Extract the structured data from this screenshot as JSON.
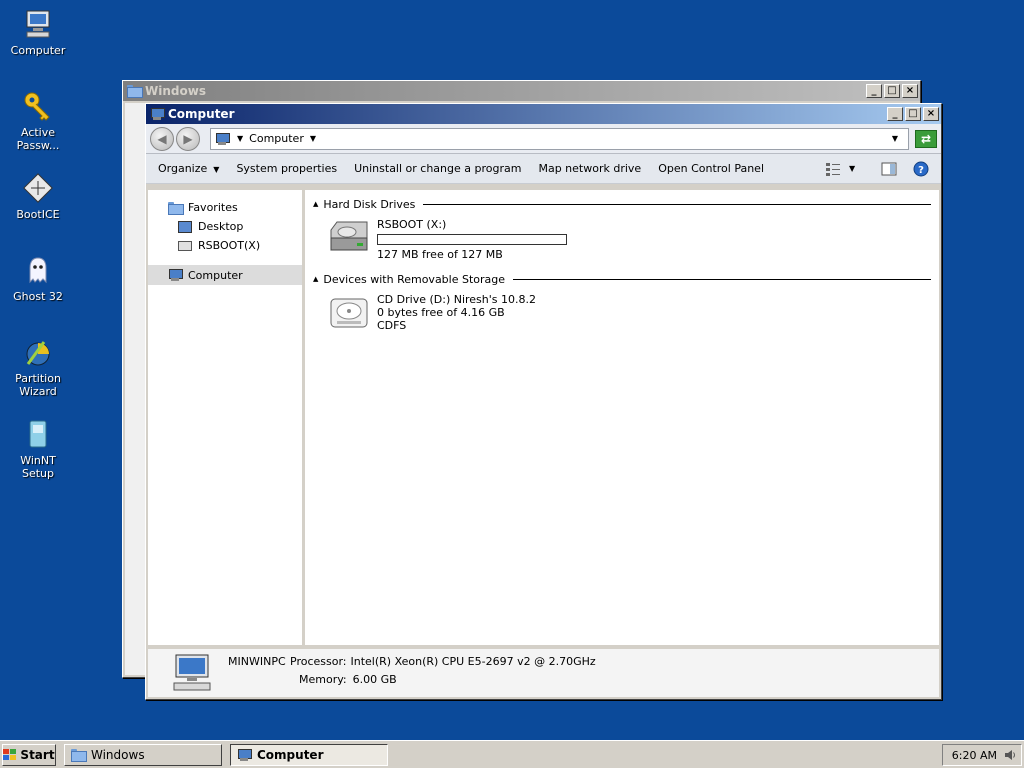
{
  "desktop": {
    "icons": [
      {
        "label": "Computer",
        "icon": "computer-icon"
      },
      {
        "label": "Active\nPassw...",
        "icon": "key-icon"
      },
      {
        "label": "BootICE",
        "icon": "bootice-icon"
      },
      {
        "label": "Ghost 32",
        "icon": "ghost-icon"
      },
      {
        "label": "Partition\nWizard",
        "icon": "partition-wizard-icon"
      },
      {
        "label": "WinNT Setup",
        "icon": "winnt-setup-icon"
      }
    ]
  },
  "back_window": {
    "title": "Windows",
    "controls": {
      "minimize": "_",
      "maximize": "□",
      "close": "×"
    }
  },
  "window": {
    "title": "Computer",
    "controls": {
      "minimize": "_",
      "maximize": "□",
      "close": "×"
    },
    "address": {
      "crumb": "Computer"
    },
    "commands": [
      {
        "label": "Organize",
        "dropdown": true
      },
      {
        "label": "System properties"
      },
      {
        "label": "Uninstall or change a program"
      },
      {
        "label": "Map network drive"
      },
      {
        "label": "Open Control Panel"
      }
    ],
    "nav": {
      "favorites": "Favorites",
      "desktop": "Desktop",
      "rsboot": "RSBOOT(X)",
      "computer": "Computer"
    },
    "groups": {
      "hdd": {
        "title": "Hard Disk Drives",
        "drive": {
          "name": "RSBOOT (X:)",
          "free": "127 MB free of 127 MB",
          "used_fraction": 0.0
        }
      },
      "removable": {
        "title": "Devices with Removable Storage",
        "drive": {
          "name": "CD Drive (D:) Niresh's 10.8.2",
          "free": "0 bytes free of 4.16 GB",
          "fs": "CDFS"
        }
      }
    },
    "details": {
      "host": "MINWINPC",
      "processor_label": "Processor:",
      "processor": "Intel(R) Xeon(R) CPU E5-2697 v2 @ 2.70GHz",
      "memory_label": "Memory:",
      "memory": "6.00 GB"
    }
  },
  "taskbar": {
    "start": "Start",
    "tasks": [
      {
        "label": "Windows",
        "active": false
      },
      {
        "label": "Computer",
        "active": true
      }
    ],
    "clock": "6:20 AM"
  },
  "colors": {
    "desktop": "#0b4a9a",
    "title_active": "#0a246a",
    "title_inactive": "#808080"
  }
}
